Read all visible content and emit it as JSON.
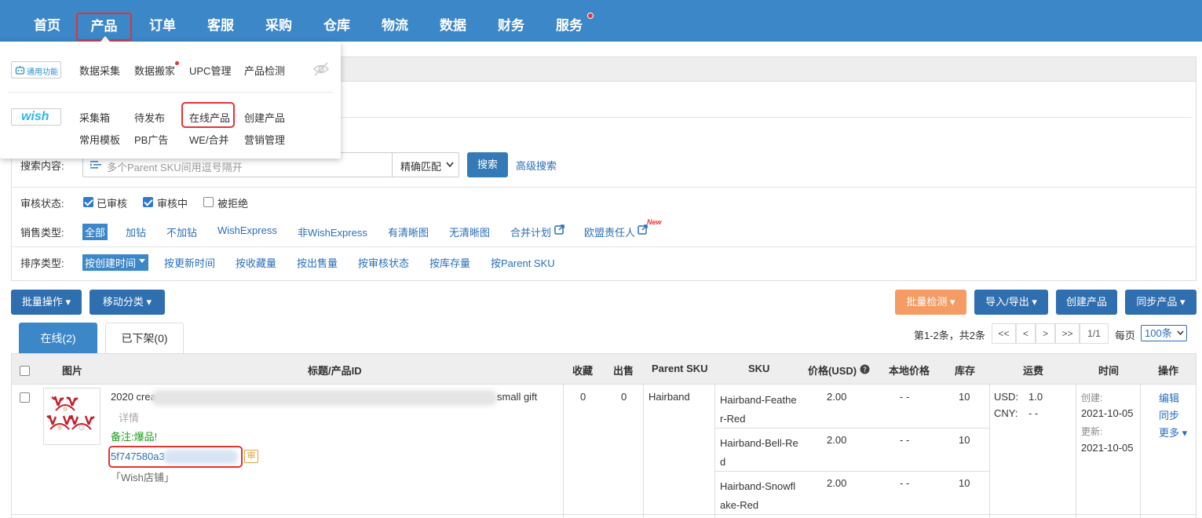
{
  "nav": {
    "items": [
      "首页",
      "产品",
      "订单",
      "客服",
      "采购",
      "仓库",
      "物流",
      "数据",
      "财务",
      "服务"
    ]
  },
  "menu": {
    "general_badge": "通用功能",
    "general_items": [
      "数据采集",
      "数据搬家",
      "UPC管理",
      "产品检测"
    ],
    "wish_badge": "wish",
    "wish_row1": [
      "采集箱",
      "待发布",
      "在线产品",
      "创建产品"
    ],
    "wish_row2": [
      "常用模板",
      "PB广告",
      "WE/合并",
      "营销管理"
    ]
  },
  "filters": {
    "search_label": "搜索内容:",
    "search_placeholder": "多个Parent SKU间用逗号隔开",
    "match_mode": "精确匹配",
    "search_button": "搜索",
    "advanced_search": "高级搜索",
    "review_label": "审核状态:",
    "review_options": [
      {
        "label": "已审核",
        "checked": true
      },
      {
        "label": "审核中",
        "checked": true
      },
      {
        "label": "被拒绝",
        "checked": false
      }
    ],
    "sale_label": "销售类型:",
    "sale_options": [
      "全部",
      "加钻",
      "不加钻",
      "WishExpress",
      "非WishExpress",
      "有清晰图",
      "无清晰图",
      "合并计划",
      "欧盟责任人"
    ],
    "new_tag": "New",
    "sort_label": "排序类型:",
    "sort_options": [
      "按创建时间",
      "按更新时间",
      "按收藏量",
      "按出售量",
      "按审核状态",
      "按库存量",
      "按Parent SKU"
    ]
  },
  "toolbar": {
    "bulk_ops": "批量操作",
    "move_category": "移动分类",
    "bulk_check": "批量检测",
    "import_export": "导入/导出",
    "create_product": "创建产品",
    "sync_product": "同步产品"
  },
  "tabs": {
    "online": "在线(2)",
    "offline": "已下架(0)"
  },
  "pager": {
    "summary": "第1-2条，共2条",
    "first": "<<",
    "prev": "<",
    "next": ">",
    "last": ">>",
    "page": "1/1",
    "per_page_label": "每页",
    "per_page": "100条"
  },
  "table": {
    "headers": [
      "图片",
      "标题/产品ID",
      "收藏",
      "出售",
      "Parent SKU",
      "SKU",
      "价格(USD)",
      "本地价格",
      "库存",
      "运费",
      "时间",
      "操作"
    ],
    "row": {
      "title_start": "2020 crea",
      "title_end": "small gift",
      "details": "详情",
      "note": "备注:爆品!",
      "product_id": "5f747580a3",
      "review_tag": "审",
      "store": "「Wish店铺」",
      "favorites": "0",
      "sold": "0",
      "parent_sku": "Hairband",
      "variants": [
        {
          "sku_line1": "Hairband-Feathe",
          "sku_line2": "r-Red",
          "price": "2.00",
          "local": "- -",
          "stock": "10"
        },
        {
          "sku_line1": "Hairband-Bell-Re",
          "sku_line2": "d",
          "price": "2.00",
          "local": "- -",
          "stock": "10"
        },
        {
          "sku_line1": "Hairband-Snowfl",
          "sku_line2": "ake-Red",
          "price": "2.00",
          "local": "- -",
          "stock": "10"
        }
      ],
      "shipping_usd_label": "USD:",
      "shipping_usd": "1.0",
      "shipping_cny_label": "CNY:",
      "shipping_cny": "- -",
      "created_label": "创建:",
      "created": "2021-10-05",
      "updated_label": "更新:",
      "updated": "2021-10-05",
      "actions": [
        "编辑",
        "同步",
        "更多"
      ]
    }
  }
}
